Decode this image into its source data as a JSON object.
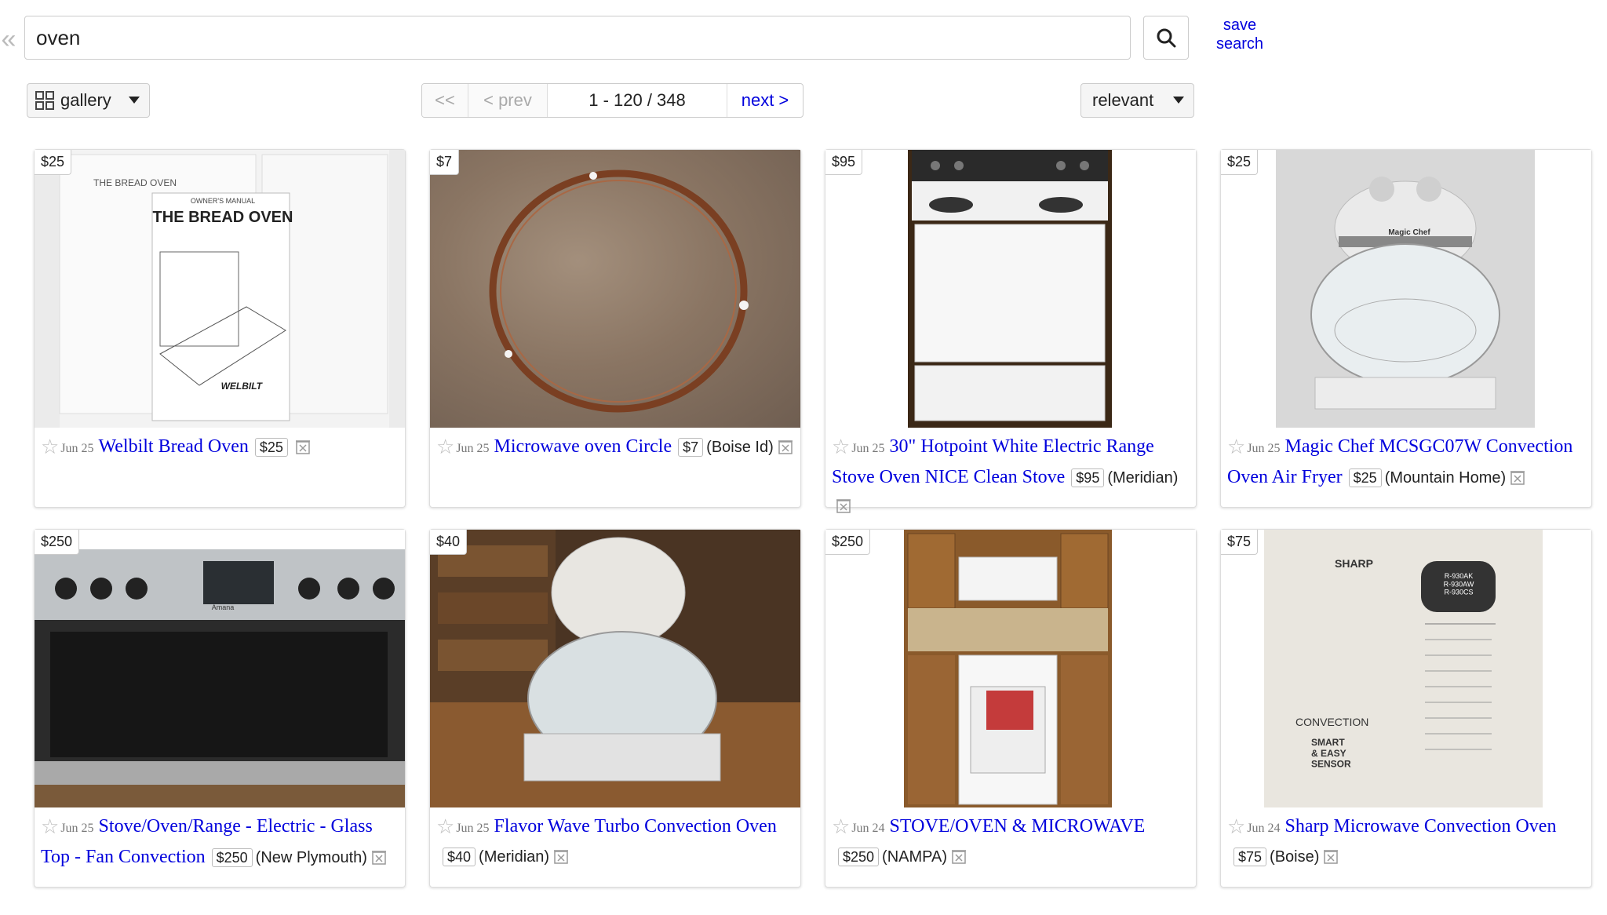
{
  "search": {
    "value": "oven",
    "save_label": "save\nsearch"
  },
  "controls": {
    "view_label": "gallery",
    "pager": {
      "first": "<<",
      "prev": "< prev",
      "range": "1 - 120 / 348",
      "next": "next >"
    },
    "sort_label": "relevant"
  },
  "listings": [
    {
      "price": "$25",
      "date": "Jun 25",
      "title": "Welbilt Bread Oven",
      "location": ""
    },
    {
      "price": "$7",
      "date": "Jun 25",
      "title": "Microwave oven Circle",
      "location": "(Boise Id)"
    },
    {
      "price": "$95",
      "date": "Jun 25",
      "title": "30\" Hotpoint White Electric Range Stove Oven NICE Clean Stove",
      "location": "(Meridian)"
    },
    {
      "price": "$25",
      "date": "Jun 25",
      "title": "Magic Chef MCSGC07W Convection Oven Air Fryer",
      "location": "(Mountain Home)"
    },
    {
      "price": "$250",
      "date": "Jun 25",
      "title": "Stove/Oven/Range - Electric - Glass Top - Fan Convection",
      "location": "(New Plymouth)"
    },
    {
      "price": "$40",
      "date": "Jun 25",
      "title": "Flavor Wave Turbo Convection Oven",
      "location": "(Meridian)"
    },
    {
      "price": "$250",
      "date": "Jun 24",
      "title": "STOVE/OVEN & MICROWAVE",
      "location": "(NAMPA)"
    },
    {
      "price": "$75",
      "date": "Jun 24",
      "title": "Sharp Microwave Convection Oven",
      "location": "(Boise)"
    }
  ],
  "photo_text": {
    "bread_box": "THE BREAD OVEN",
    "bread_manual_header": "OWNER'S MANUAL",
    "bread_manual_title": "THE BREAD OVEN",
    "bread_brand": "WELBILT",
    "chef_brand": "Magic Chef",
    "stove_brand": "Amana",
    "manual_brand": "SHARP",
    "manual_models": "R-930AK\nR-930AW\nR-930CS",
    "manual_title": "CONVECTION",
    "manual_sensor": "SMART\n& EASY\nSENSOR"
  },
  "colors": {
    "link": "#0000dd",
    "border": "#cccccc",
    "muted": "#777777"
  }
}
